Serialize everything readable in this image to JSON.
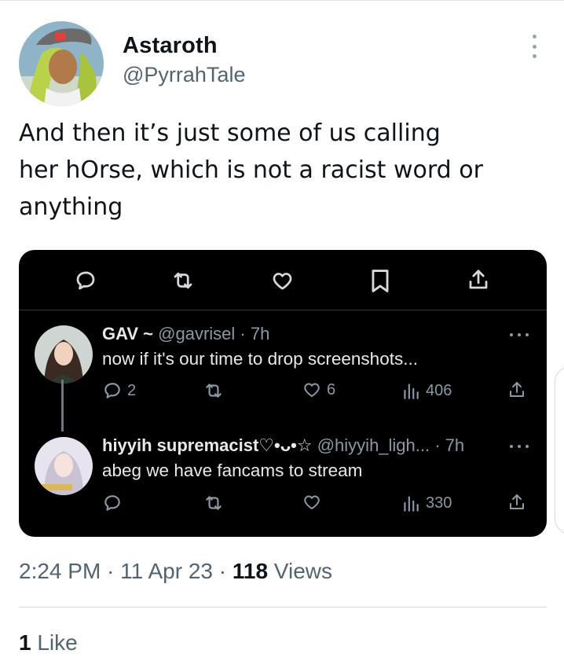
{
  "author": {
    "name": "Astaroth",
    "handle": "@PyrrahTale"
  },
  "tweet": {
    "text_lines": [
      "And then it’s just some of us calling",
      "her hOrse, which is not a racist word or",
      "anything"
    ]
  },
  "quote_card": {
    "action_icons": [
      "reply-icon",
      "retweet-icon",
      "like-icon",
      "bookmark-icon",
      "share-icon"
    ],
    "replies": [
      {
        "name": "GAV ~",
        "meta": "@gavrisel · 7h",
        "text": "now if it's our time to drop screenshots...",
        "replies_count": "2",
        "likes_count": "6",
        "views_count": "406"
      },
      {
        "name": "hiyyih supremacist♡•ᴗ•☆",
        "meta": "@hiyyih_ligh... · 7h",
        "text": "abeg we have fancams to stream",
        "replies_count": "",
        "likes_count": "",
        "views_count": "330"
      }
    ]
  },
  "footer": {
    "time": "2:24 PM",
    "sep1": " · ",
    "date": "11 Apr 23",
    "sep2": " · ",
    "views_num": "118",
    "views_label": " Views",
    "likes_num": "1",
    "likes_label": " Like"
  },
  "colors": {
    "text_primary": "#0f1419",
    "text_secondary": "#536471",
    "card_bg": "#000000",
    "card_text": "#e7e9ea",
    "card_meta": "#8b98a5"
  }
}
